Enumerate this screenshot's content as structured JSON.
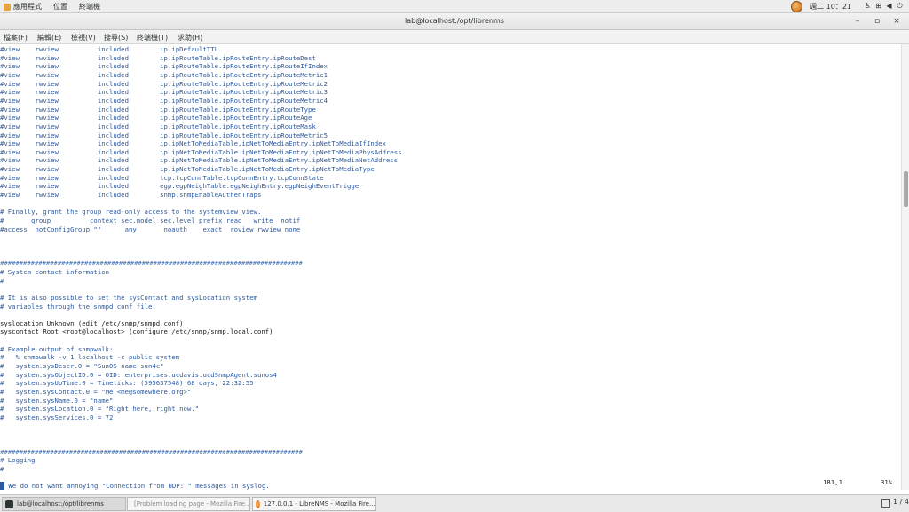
{
  "topbar": {
    "applications": "應用程式",
    "places": "位置",
    "terminal": "終端機",
    "clock": "週二 10：21"
  },
  "window": {
    "title": "lab@localhost:/opt/librenms",
    "minimize": "–",
    "maximize": "▫",
    "close": "×"
  },
  "menubar": {
    "file": "檔案(F)",
    "edit": "編輯(E)",
    "view": "檢視(V)",
    "search": "搜尋(S)",
    "terminal": "終端機(T)",
    "help": "求助(H)"
  },
  "terminal_lines": [
    "#view    rwview          included        ip.ipDefaultTTL",
    "#view    rwview          included        ip.ipRouteTable.ipRouteEntry.ipRouteDest",
    "#view    rwview          included        ip.ipRouteTable.ipRouteEntry.ipRouteIfIndex",
    "#view    rwview          included        ip.ipRouteTable.ipRouteEntry.ipRouteMetric1",
    "#view    rwview          included        ip.ipRouteTable.ipRouteEntry.ipRouteMetric2",
    "#view    rwview          included        ip.ipRouteTable.ipRouteEntry.ipRouteMetric3",
    "#view    rwview          included        ip.ipRouteTable.ipRouteEntry.ipRouteMetric4",
    "#view    rwview          included        ip.ipRouteTable.ipRouteEntry.ipRouteType",
    "#view    rwview          included        ip.ipRouteTable.ipRouteEntry.ipRouteAge",
    "#view    rwview          included        ip.ipRouteTable.ipRouteEntry.ipRouteMask",
    "#view    rwview          included        ip.ipRouteTable.ipRouteEntry.ipRouteMetric5",
    "#view    rwview          included        ip.ipNetToMediaTable.ipNetToMediaEntry.ipNetToMediaIfIndex",
    "#view    rwview          included        ip.ipNetToMediaTable.ipNetToMediaEntry.ipNetToMediaPhysAddress",
    "#view    rwview          included        ip.ipNetToMediaTable.ipNetToMediaEntry.ipNetToMediaNetAddress",
    "#view    rwview          included        ip.ipNetToMediaTable.ipNetToMediaEntry.ipNetToMediaType",
    "#view    rwview          included        tcp.tcpConnTable.tcpConnEntry.tcpConnState",
    "#view    rwview          included        egp.egpNeighTable.egpNeighEntry.egpNeighEventTrigger",
    "#view    rwview          included        snmp.snmpEnableAuthenTraps",
    "",
    "# Finally, grant the group read-only access to the systemview view.",
    "#       group          context sec.model sec.level prefix read   write  notif",
    "#access  notConfigGroup \"\"      any       noauth    exact  roview rwview none",
    "",
    "",
    "",
    "###############################################################################",
    "# System contact information",
    "#",
    "",
    "# It is also possible to set the sysContact and sysLocation system",
    "# variables through the snmpd.conf file:",
    "",
    "syslocation Unknown (edit /etc/snmp/snmpd.conf)",
    "syscontact Root <root@localhost> (configure /etc/snmp/snmp.local.conf)",
    "",
    "# Example output of snmpwalk:",
    "#   % snmpwalk -v 1 localhost -c public system",
    "#   system.sysDescr.0 = \"SunOS name sun4c\"",
    "#   system.sysObjectID.0 = OID: enterprises.ucdavis.ucdSnmpAgent.sunos4",
    "#   system.sysUpTime.0 = Timeticks: (595637548) 68 days, 22:32:55",
    "#   system.sysContact.0 = \"Me <me@somewhere.org>\"",
    "#   system.sysName.0 = \"name\"",
    "#   system.sysLocation.0 = \"Right here, right now.\"",
    "#   system.sysServices.0 = 72",
    "",
    "",
    "",
    "###############################################################################",
    "# Logging",
    "#",
    "",
    "# We do not want annoying \"Connection from UDP: \" messages in syslog."
  ],
  "status": {
    "position": "181,1",
    "percent": "31%"
  },
  "scrollbar": {
    "position": 0.31
  },
  "taskbar": {
    "task1": "lab@localhost:/opt/librenms",
    "task2": "[Problem loading page - Mozilla Fire…",
    "task3": "127.0.0.1 - LibreNMS - Mozilla Fire…",
    "workspace": "1 / 4"
  },
  "icons": {
    "apps": "applications-icon",
    "user": "user-avatar-icon",
    "accessibility": "accessibility-icon",
    "network": "network-icon",
    "volume": "volume-icon",
    "power": "power-icon",
    "terminal": "terminal-icon",
    "firefox": "firefox-icon",
    "workspace": "workspace-icon"
  }
}
